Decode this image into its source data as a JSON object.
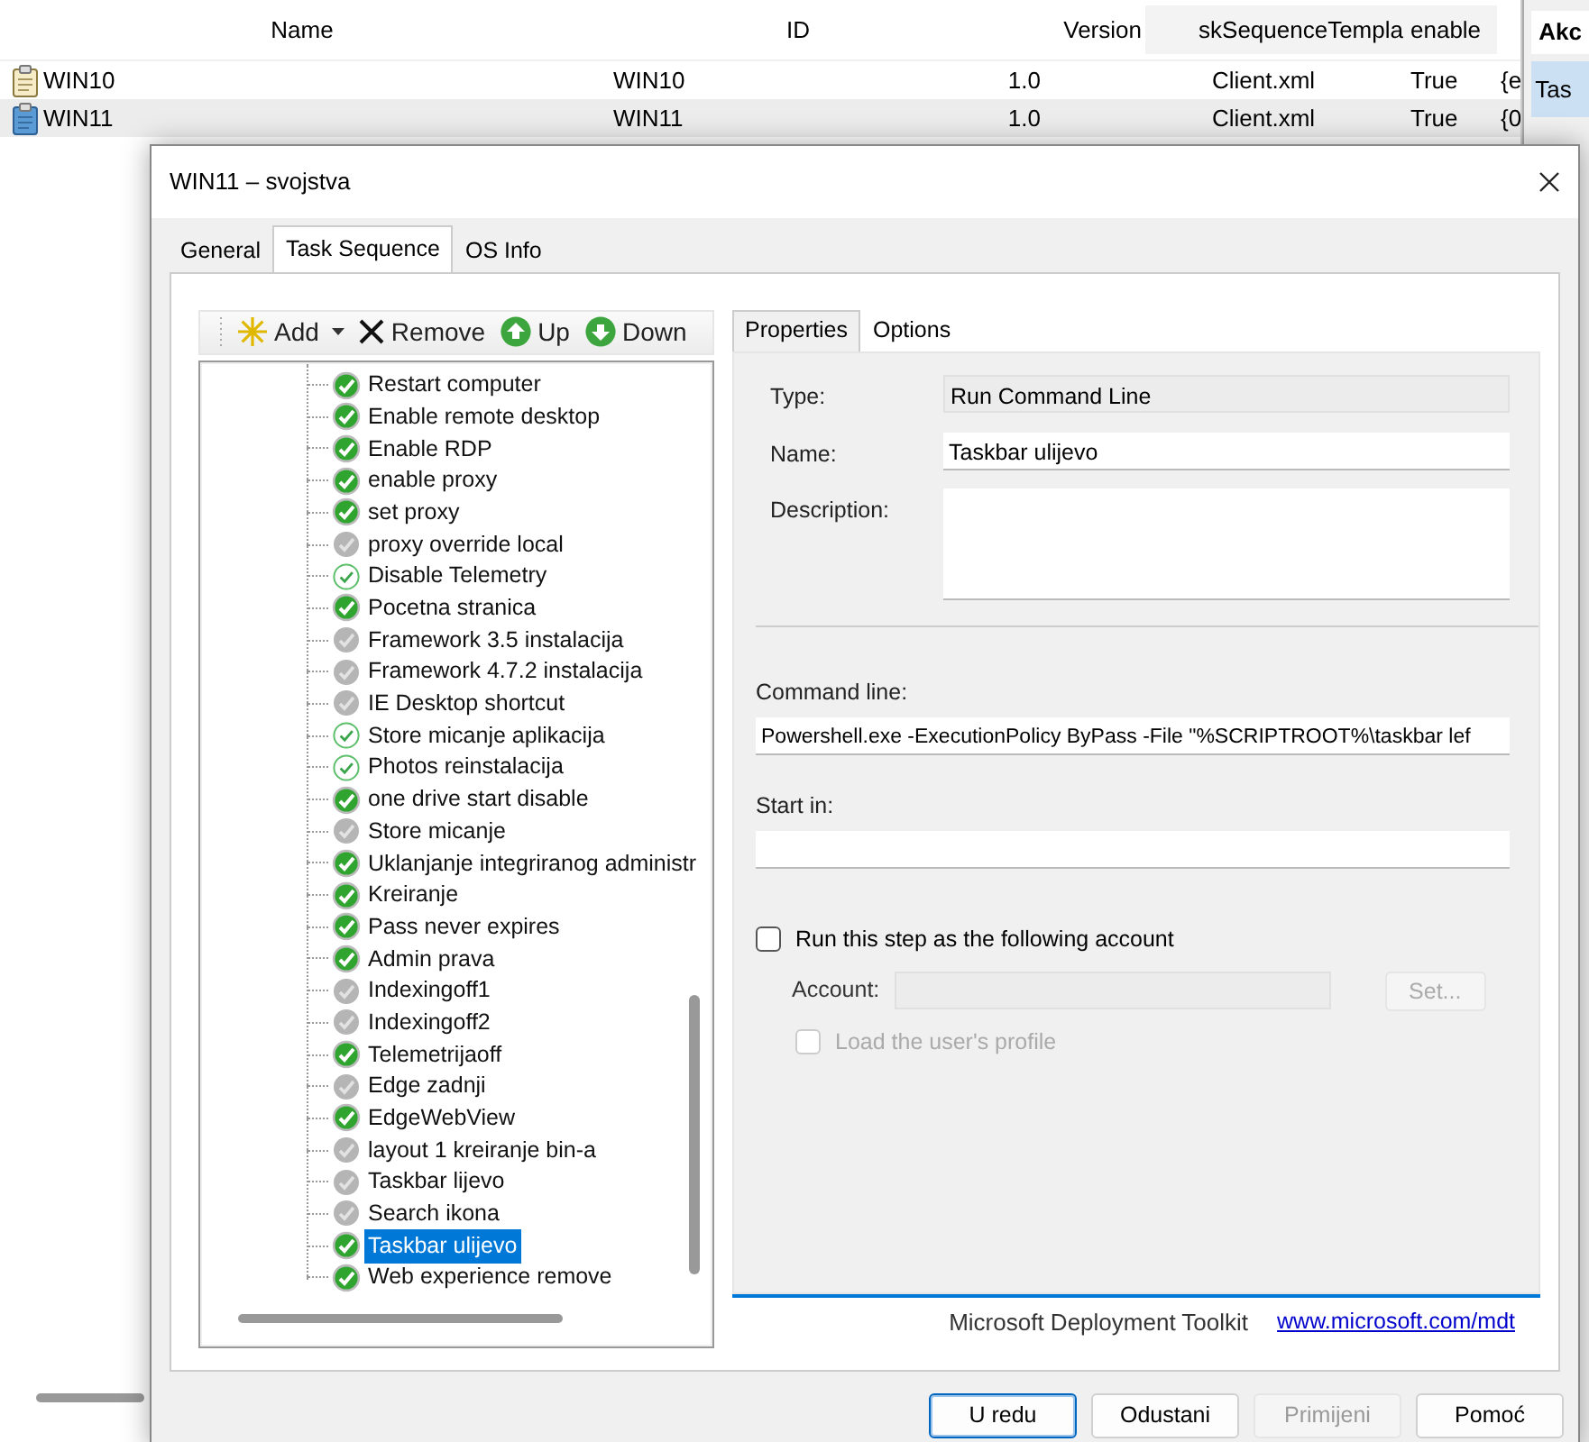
{
  "background_window": {
    "columns": [
      "Name",
      "ID",
      "Version",
      "skSequenceTempla",
      "enable"
    ],
    "rows": [
      {
        "selected": false,
        "kind": "plain",
        "cells": [
          "WIN10",
          "WIN10",
          "1.0",
          "Client.xml",
          "True",
          "{e"
        ]
      },
      {
        "selected": true,
        "kind": "blue",
        "cells": [
          "WIN11",
          "WIN11",
          "1.0",
          "Client.xml",
          "True",
          "{0"
        ]
      }
    ]
  },
  "actions_pane": {
    "title": "Akc",
    "items": [
      {
        "label": "Tas",
        "selected": true
      }
    ]
  },
  "dialog": {
    "title": "WIN11 – svojstva",
    "tabs": [
      {
        "label": "General",
        "selected": false
      },
      {
        "label": "Task Sequence",
        "selected": true
      },
      {
        "label": "OS Info",
        "selected": false
      }
    ],
    "toolbar": [
      {
        "label": "Add",
        "kind": "add"
      },
      {
        "label": "Remove",
        "kind": "remove"
      },
      {
        "label": "Up",
        "kind": "up"
      },
      {
        "label": "Down",
        "kind": "down"
      }
    ],
    "tree": {
      "items": [
        {
          "label": "Restart computer",
          "kind": "enabled",
          "selected": false
        },
        {
          "label": "Enable remote desktop",
          "kind": "enabled",
          "selected": false
        },
        {
          "label": "Enable RDP",
          "kind": "enabled",
          "selected": false
        },
        {
          "label": "enable proxy",
          "kind": "enabled",
          "selected": false
        },
        {
          "label": "set proxy",
          "kind": "enabled",
          "selected": false
        },
        {
          "label": "proxy override local",
          "kind": "disabled",
          "selected": false
        },
        {
          "label": "Disable Telemetry",
          "kind": "light",
          "selected": false
        },
        {
          "label": "Pocetna stranica",
          "kind": "enabled",
          "selected": false
        },
        {
          "label": "Framework 3.5 instalacija",
          "kind": "disabled",
          "selected": false
        },
        {
          "label": "Framework 4.7.2 instalacija",
          "kind": "disabled",
          "selected": false
        },
        {
          "label": "IE Desktop shortcut",
          "kind": "disabled",
          "selected": false
        },
        {
          "label": "Store micanje aplikacija",
          "kind": "light",
          "selected": false
        },
        {
          "label": "Photos reinstalacija",
          "kind": "light",
          "selected": false
        },
        {
          "label": "one drive start disable",
          "kind": "enabled",
          "selected": false
        },
        {
          "label": "Store micanje",
          "kind": "disabled",
          "selected": false
        },
        {
          "label": "Uklanjanje integriranog administr",
          "kind": "enabled",
          "selected": false
        },
        {
          "label": "Kreiranje",
          "kind": "enabled",
          "selected": false
        },
        {
          "label": "Pass never expires",
          "kind": "enabled",
          "selected": false
        },
        {
          "label": "Admin prava",
          "kind": "enabled",
          "selected": false
        },
        {
          "label": "Indexingoff1",
          "kind": "disabled",
          "selected": false
        },
        {
          "label": "Indexingoff2",
          "kind": "disabled",
          "selected": false
        },
        {
          "label": "Telemetrijaoff",
          "kind": "enabled",
          "selected": false
        },
        {
          "label": "Edge zadnji",
          "kind": "disabled",
          "selected": false
        },
        {
          "label": "EdgeWebView",
          "kind": "enabled",
          "selected": false
        },
        {
          "label": "layout 1 kreiranje bin-a",
          "kind": "disabled",
          "selected": false
        },
        {
          "label": "Taskbar lijevo",
          "kind": "disabled",
          "selected": false
        },
        {
          "label": "Search ikona",
          "kind": "disabled",
          "selected": false
        },
        {
          "label": "Taskbar ulijevo",
          "kind": "enabled",
          "selected": true
        },
        {
          "label": "Web experience remove",
          "kind": "enabled",
          "selected": false
        }
      ]
    },
    "properties": {
      "tabs": [
        {
          "label": "Properties",
          "selected": true
        },
        {
          "label": "Options",
          "selected": false
        }
      ],
      "type": {
        "label": "Type:",
        "value": "Run Command Line"
      },
      "name": {
        "label": "Name:",
        "value": "Taskbar ulijevo"
      },
      "description": {
        "label": "Description:"
      },
      "command_line": {
        "label": "Command line:",
        "value": "Powershell.exe -ExecutionPolicy ByPass -File \"%SCRIPTROOT%\\taskbar lef"
      },
      "start_in": {
        "label": "Start in:"
      },
      "run_as": {
        "label": "Run this step as the following account",
        "checked": false
      },
      "account": {
        "label": "Account:",
        "disabled": true
      },
      "set_button": {
        "label": "Set...",
        "disabled": true
      },
      "load_profile": {
        "label": "Load the user's profile",
        "checked": false,
        "disabled": true
      },
      "footer": {
        "text": "Microsoft Deployment Toolkit",
        "link": "www.microsoft.com/mdt"
      }
    },
    "buttons": [
      {
        "label": "U redu",
        "default": true,
        "disabled": false
      },
      {
        "label": "Odustani",
        "default": false,
        "disabled": false
      },
      {
        "label": "Primijeni",
        "default": false,
        "disabled": true
      },
      {
        "label": "Pomoć",
        "default": false,
        "disabled": false
      }
    ]
  }
}
